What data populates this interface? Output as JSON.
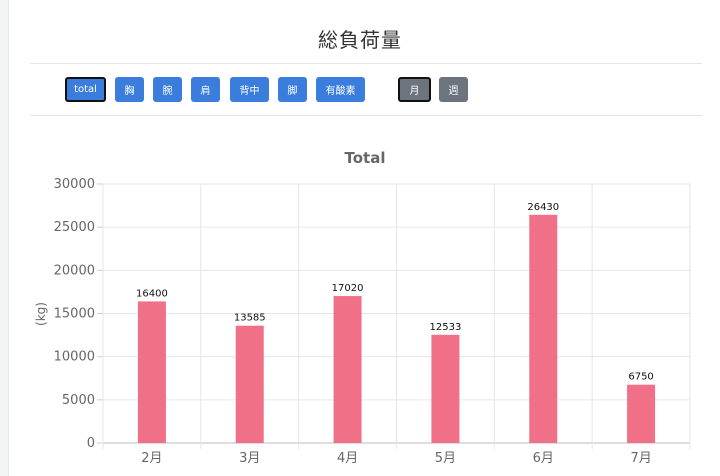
{
  "page": {
    "title": "総負荷量"
  },
  "filters": {
    "parts": [
      {
        "label": "total",
        "active": true
      },
      {
        "label": "胸",
        "active": false
      },
      {
        "label": "腕",
        "active": false
      },
      {
        "label": "肩",
        "active": false
      },
      {
        "label": "背中",
        "active": false
      },
      {
        "label": "脚",
        "active": false
      },
      {
        "label": "有酸素",
        "active": false
      }
    ],
    "periods": [
      {
        "label": "月",
        "active": true
      },
      {
        "label": "週",
        "active": false
      }
    ]
  },
  "colors": {
    "primary": "#3b7ddd",
    "secondary": "#6c757d",
    "bar": "#f07087"
  },
  "chart_data": {
    "type": "bar",
    "title": "Total",
    "xlabel": "",
    "ylabel": "(kg)",
    "categories": [
      "2月",
      "3月",
      "4月",
      "5月",
      "6月",
      "7月"
    ],
    "values": [
      16400,
      13585,
      17020,
      12533,
      26430,
      6750
    ],
    "ylim": [
      0,
      30000
    ],
    "yticks": [
      0,
      5000,
      10000,
      15000,
      20000,
      25000,
      30000
    ],
    "grid": true,
    "legend": "none"
  }
}
